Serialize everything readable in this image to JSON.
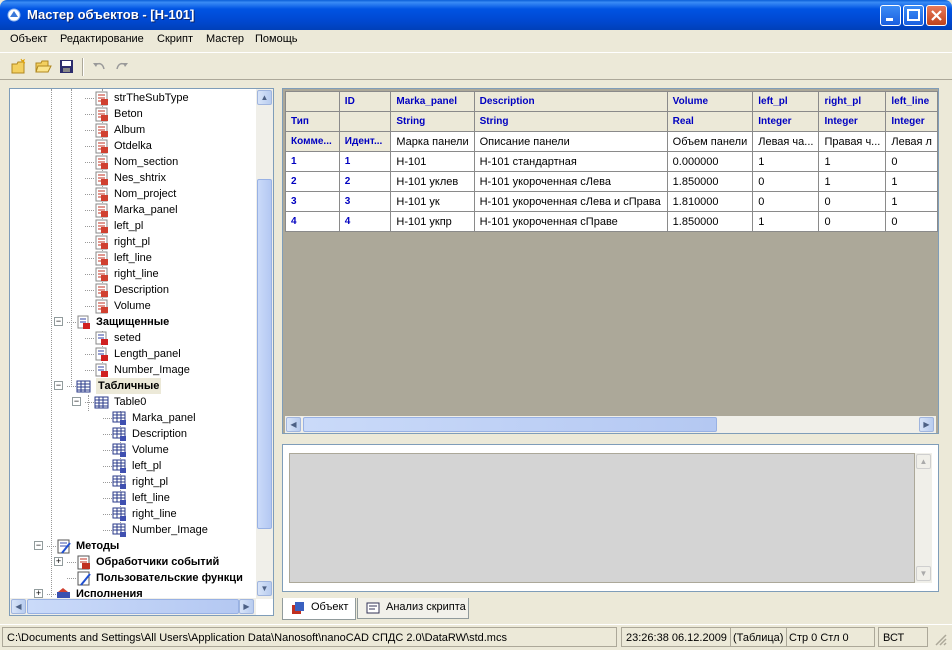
{
  "window": {
    "title": "Мастер объектов - [H-101]"
  },
  "menu": [
    "Объект",
    "Редактирование",
    "Скрипт",
    "Мастер",
    "Помощь"
  ],
  "tree": {
    "items": [
      {
        "label": "strTheSubType"
      },
      {
        "label": "Beton"
      },
      {
        "label": "Album"
      },
      {
        "label": "Otdelka"
      },
      {
        "label": "Nom_section"
      },
      {
        "label": "Nes_shtrix"
      },
      {
        "label": "Nom_project"
      },
      {
        "label": "Marka_panel"
      },
      {
        "label": "left_pl"
      },
      {
        "label": "right_pl"
      },
      {
        "label": "left_line"
      },
      {
        "label": "right_line"
      },
      {
        "label": "Description"
      },
      {
        "label": "Volume"
      },
      {
        "label": "Защищенные"
      },
      {
        "label": "seted"
      },
      {
        "label": "Length_panel"
      },
      {
        "label": "Number_Image"
      },
      {
        "label": "Табличные"
      },
      {
        "label": "Table0"
      },
      {
        "label": "Marka_panel"
      },
      {
        "label": "Description"
      },
      {
        "label": "Volume"
      },
      {
        "label": "left_pl"
      },
      {
        "label": "right_pl"
      },
      {
        "label": "left_line"
      },
      {
        "label": "right_line"
      },
      {
        "label": "Number_Image"
      },
      {
        "label": "Методы"
      },
      {
        "label": "Обработчики событий"
      },
      {
        "label": "Пользовательские функци"
      },
      {
        "label": "Исполнения"
      }
    ]
  },
  "grid": {
    "columns": [
      {
        "name": "ID",
        "type": "",
        "comment": "Идент..."
      },
      {
        "name": "Marka_panel",
        "type": "String",
        "comment": "Марка панели"
      },
      {
        "name": "Description",
        "type": "String",
        "comment": "Описание панели"
      },
      {
        "name": "Volume",
        "type": "Real",
        "comment": "Объем панели"
      },
      {
        "name": "left_pl",
        "type": "Integer",
        "comment": "Левая ча..."
      },
      {
        "name": "right_pl",
        "type": "Integer",
        "comment": "Правая ч..."
      },
      {
        "name": "left_line",
        "type": "Integer",
        "comment": "Левая л"
      }
    ],
    "row_labels": {
      "type": "Тип",
      "comment": "Комме..."
    },
    "rows": [
      {
        "n": "1",
        "cells": [
          "1",
          "H-101",
          "H-101 стандартная",
          "0.000000",
          "1",
          "1",
          "0"
        ]
      },
      {
        "n": "2",
        "cells": [
          "2",
          "H-101 уклев",
          "H-101 укороченная сЛева",
          "1.850000",
          "0",
          "1",
          "1"
        ]
      },
      {
        "n": "3",
        "cells": [
          "3",
          "H-101 ук",
          "H-101 укороченная сЛева и сПрава",
          "1.810000",
          "0",
          "0",
          "1"
        ]
      },
      {
        "n": "4",
        "cells": [
          "4",
          "H-101 укпр",
          "H-101 укороченная сПраве",
          "1.850000",
          "1",
          "0",
          "0"
        ]
      }
    ]
  },
  "tabs": [
    "Объект",
    "Анализ скрипта"
  ],
  "status": {
    "path": "C:\\Documents and Settings\\All Users\\Application Data\\Nanosoft\\nanoCAD СПДС 2.0\\DataRW\\std.mcs",
    "time": "23:26:38  06.12.2009",
    "mode": "(Таблица)",
    "position": "Стр 0 Стл 0",
    "insert": "ВСТ"
  }
}
